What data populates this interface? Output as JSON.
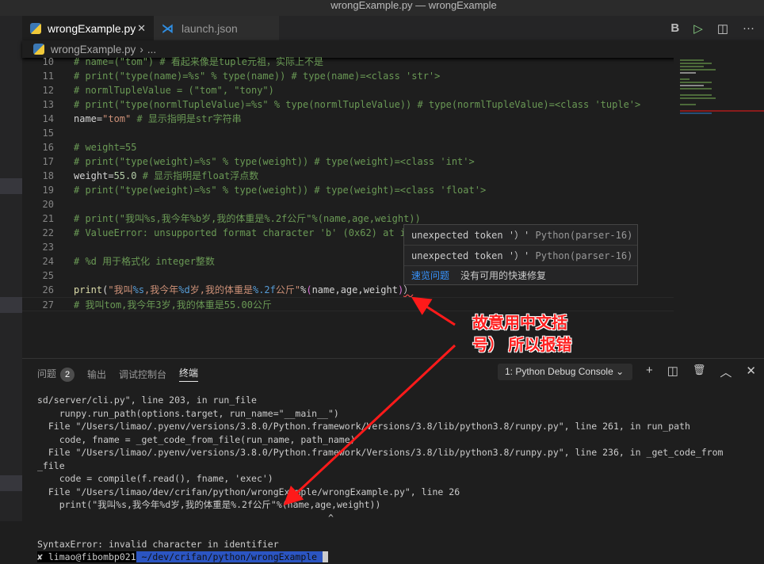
{
  "window_title": "wrongExample.py — wrongExample",
  "tabs": [
    {
      "label": "wrongExample.py",
      "icon": "python-icon"
    },
    {
      "label": "launch.json",
      "icon": "vscode-icon"
    }
  ],
  "actions": {
    "b": "B",
    "run": "▷",
    "split": "◫",
    "more": "···"
  },
  "breadcrumb": {
    "file": "wrongExample.py",
    "sep": "›",
    "rest": "..."
  },
  "code_lines": [
    {
      "n": "10",
      "t": "# name=(\"tom\") # 看起来像是tuple元祖，实际上不是"
    },
    {
      "n": "11",
      "t": "# print(\"type(name)=%s\" % type(name)) # type(name)=<class 'str'>"
    },
    {
      "n": "12",
      "t": "# normlTupleValue = (\"tom\", \"tony\")"
    },
    {
      "n": "13",
      "t": "# print(\"type(normlTupleValue)=%s\" % type(normlTupleValue)) # type(normlTupleValue)=<class 'tuple'>"
    },
    {
      "n": "14",
      "a": "name=",
      "b": "\"tom\"",
      "c": " # 显示指明是str字符串"
    },
    {
      "n": "15",
      "t": ""
    },
    {
      "n": "16",
      "t": "# weight=55"
    },
    {
      "n": "17",
      "t": "# print(\"type(weight)=%s\" % type(weight)) # type(weight)=<class 'int'>"
    },
    {
      "n": "18",
      "a": "weight=",
      "b": "55.0",
      "c": " # 显示指明是float浮点数"
    },
    {
      "n": "19",
      "t": "# print(\"type(weight)=%s\" % type(weight)) # type(weight)=<class 'float'>"
    },
    {
      "n": "20",
      "t": ""
    },
    {
      "n": "21",
      "t": "# print(\"我叫%s,我今年%b岁,我的体重是%.2f公斤\"%(name,age,weight))"
    },
    {
      "n": "22",
      "t": "# ValueError: unsupported format character 'b' (0x62) at i"
    },
    {
      "n": "23",
      "t": ""
    },
    {
      "n": "24",
      "t": "# %d 用于格式化 integer整数"
    },
    {
      "n": "25",
      "t": ""
    },
    {
      "n": "26",
      "p": [
        "print",
        "(",
        "\"我叫",
        "%s",
        ",我今年",
        "%d",
        "岁,我的体重是",
        "%.2f",
        "公斤\"",
        "%",
        "(",
        "name,age,weight",
        ")",
        "）"
      ]
    },
    {
      "n": "27",
      "t": "# 我叫tom,我今年3岁,我的体重是55.00公斤"
    }
  ],
  "hover": {
    "problems": [
      {
        "msg": "unexpected token '）'",
        "src": "Python(parser-16)"
      },
      {
        "msg": "unexpected token '）'",
        "src": "Python(parser-16)"
      }
    ],
    "peek": "速览问题",
    "no_fix": "没有可用的快速修复"
  },
  "annotation": {
    "line1": "故意用中文括",
    "line2": "号） 所以报错",
    "color": "#ff2020"
  },
  "panel": {
    "tabs": [
      "问题",
      "输出",
      "调试控制台",
      "终端"
    ],
    "problems_count": "2",
    "console_select": "1: Python Debug Console ⌄",
    "icons": {
      "add": "+",
      "split": "◫",
      "trash": "🗑",
      "up": "︿",
      "close": "✕"
    }
  },
  "terminal": [
    "sd/server/cli.py\", line 203, in run_file",
    "    runpy.run_path(options.target, run_name=\"__main__\")",
    "  File \"/Users/limao/.pyenv/versions/3.8.0/Python.framework/Versions/3.8/lib/python3.8/runpy.py\", line 261, in run_path",
    "    code, fname = _get_code_from_file(run_name, path_name)",
    "  File \"/Users/limao/.pyenv/versions/3.8.0/Python.framework/Versions/3.8/lib/python3.8/runpy.py\", line 236, in _get_code_from",
    "_file",
    "    code = compile(f.read(), fname, 'exec')",
    "  File \"/Users/limao/dev/crifan/python/wrongExample/wrongExample.py\", line 26",
    "    print(\"我叫%s,我今年%d岁,我的体重是%.2f公斤\"%(name,age,weight))",
    "                                                     ^",
    "",
    "SyntaxError: invalid character in identifier"
  ],
  "prompt": {
    "user": "✘ limao@fibombp021",
    "path": " ~/dev/crifan/python/wrongExample "
  }
}
